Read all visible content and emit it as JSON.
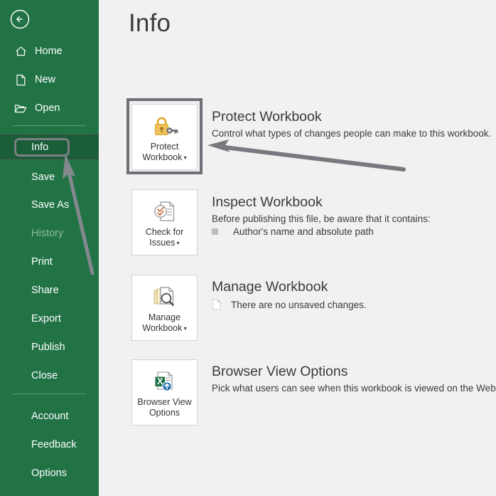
{
  "app": {
    "accent_green": "#217346",
    "content_bg": "#f1f1f1",
    "annotation_gray": "#7b7f85"
  },
  "sidebar": {
    "back_label": "Back",
    "items": [
      {
        "label": "Home",
        "icon": "home-icon",
        "state": "normal"
      },
      {
        "label": "New",
        "icon": "page-icon",
        "state": "normal"
      },
      {
        "label": "Open",
        "icon": "folder-icon",
        "state": "normal"
      },
      {
        "label": "Info",
        "icon": "none",
        "state": "selected"
      },
      {
        "label": "Save",
        "icon": "none",
        "state": "normal"
      },
      {
        "label": "Save As",
        "icon": "none",
        "state": "normal"
      },
      {
        "label": "History",
        "icon": "none",
        "state": "disabled"
      },
      {
        "label": "Print",
        "icon": "none",
        "state": "normal"
      },
      {
        "label": "Share",
        "icon": "none",
        "state": "normal"
      },
      {
        "label": "Export",
        "icon": "none",
        "state": "normal"
      },
      {
        "label": "Publish",
        "icon": "none",
        "state": "normal"
      },
      {
        "label": "Close",
        "icon": "none",
        "state": "normal"
      },
      {
        "label": "Account",
        "icon": "none",
        "state": "normal"
      },
      {
        "label": "Feedback",
        "icon": "none",
        "state": "normal"
      },
      {
        "label": "Options",
        "icon": "none",
        "state": "normal"
      }
    ]
  },
  "main": {
    "title": "Info",
    "sections": [
      {
        "id": "protect-workbook",
        "tile_label_line1": "Protect",
        "tile_label_line2": "Workbook",
        "tile_icon": "padlock-key-icon",
        "has_caret": true,
        "heading": "Protect Workbook",
        "description": "Control what types of changes people can make to this workbook.",
        "bullets": []
      },
      {
        "id": "inspect-workbook",
        "tile_label_line1": "Check for",
        "tile_label_line2": "Issues",
        "tile_icon": "document-check-icon",
        "has_caret": true,
        "heading": "Inspect Workbook",
        "description": "Before publishing this file, be aware that it contains:",
        "bullets": [
          {
            "marker": "square",
            "text": "Author's name and absolute path"
          }
        ]
      },
      {
        "id": "manage-workbook",
        "tile_label_line1": "Manage",
        "tile_label_line2": "Workbook",
        "tile_icon": "documents-magnifier-icon",
        "has_caret": true,
        "heading": "Manage Workbook",
        "description": "",
        "bullets": [
          {
            "marker": "document",
            "text": "There are no unsaved changes."
          }
        ]
      },
      {
        "id": "browser-view-options",
        "tile_label_line1": "Browser View",
        "tile_label_line2": "Options",
        "tile_icon": "excel-upload-icon",
        "has_caret": false,
        "heading": "Browser View Options",
        "description": "Pick what users can see when this workbook is viewed on the Web.",
        "bullets": []
      }
    ]
  },
  "annotations": {
    "info_callout_target": "Info",
    "protect_callout_target": "Protect Workbook"
  }
}
